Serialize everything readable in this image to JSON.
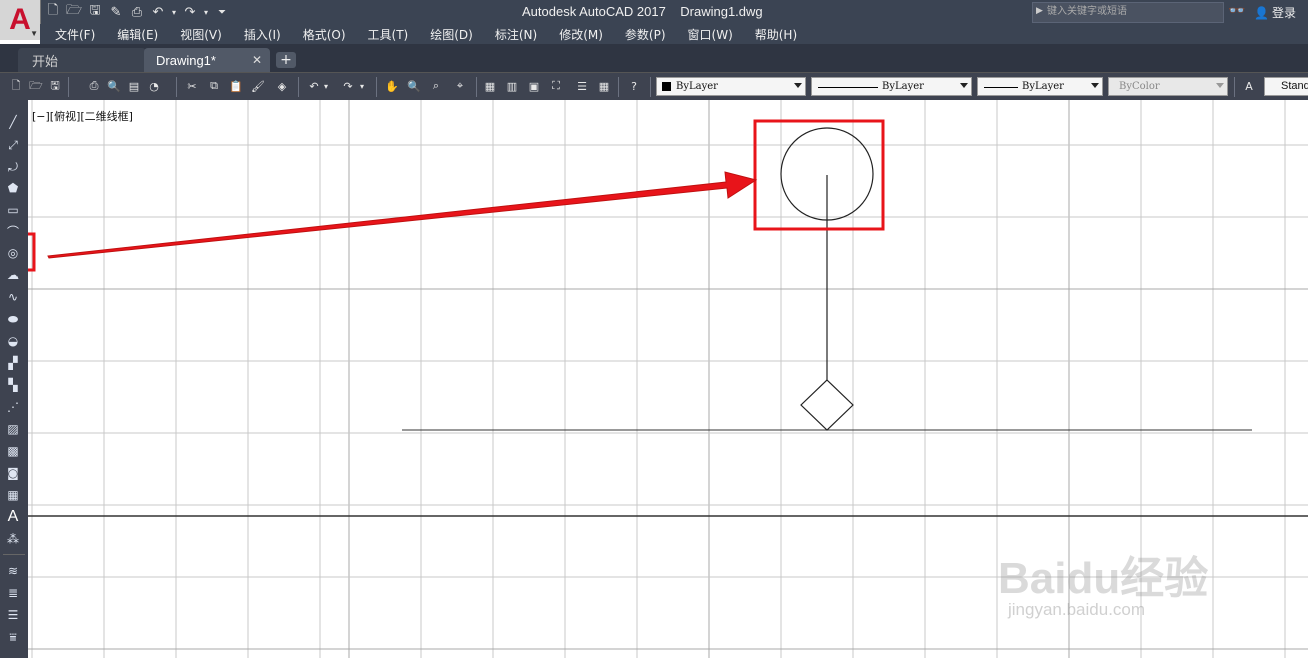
{
  "app": {
    "logo_letter": "A",
    "title": "Autodesk AutoCAD 2017    Drawing1.dwg",
    "search_placeholder": "键入关键字或短语",
    "login_label": "登录"
  },
  "menu": [
    "文件(F)",
    "编辑(E)",
    "视图(V)",
    "插入(I)",
    "格式(O)",
    "工具(T)",
    "绘图(D)",
    "标注(N)",
    "修改(M)",
    "参数(P)",
    "窗口(W)",
    "帮助(H)"
  ],
  "tabs": [
    {
      "label": "开始",
      "active": false
    },
    {
      "label": "Drawing1*",
      "active": true
    }
  ],
  "toolbar": {
    "color_value": "ByLayer",
    "linetype_value": "ByLayer",
    "lineweight_value": "ByLayer",
    "plotstyle_value": "ByColor",
    "textstyle_value": "Stand"
  },
  "viewport": {
    "label": "[−][俯视][二维线框]"
  },
  "draw_tools": [
    "line-icon",
    "construction-line-icon",
    "polyline-icon",
    "polygon-icon",
    "rectangle-icon",
    "arc-icon",
    "circle-icon",
    "revision-cloud-icon",
    "spline-icon",
    "ellipse-icon",
    "ellipse-arc-icon",
    "insert-block-icon",
    "make-block-icon",
    "point-icon",
    "hatch-icon",
    "gradient-icon",
    "region-icon",
    "table-icon",
    "multiline-text-icon",
    "add-selected-icon"
  ],
  "watermark": {
    "brand": "Baidu经验",
    "url": "jingyan.baidu.com"
  },
  "colors": {
    "title_bg": "#3b4453",
    "toolbar_bg": "#3e4350",
    "annotation_red": "#e8141a",
    "grid": "#c8c8c8"
  }
}
